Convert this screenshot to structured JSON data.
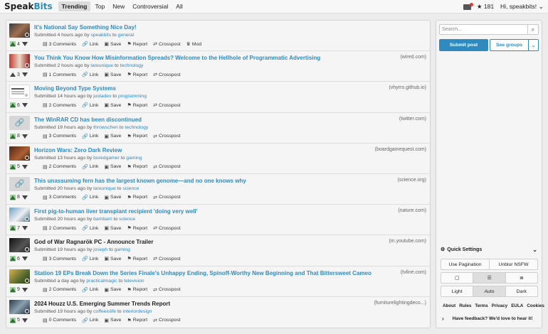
{
  "header": {
    "brand_a": "Speak",
    "brand_b": "Bits",
    "tabs": [
      "Trending",
      "Top",
      "New",
      "Controversial",
      "All"
    ],
    "active_tab": "Trending",
    "score": "181",
    "greeting": "Hi, speakbits!",
    "mail_icon": "mail-icon"
  },
  "labels": {
    "comments_suffix": "Comments",
    "link": "Link",
    "save": "Save",
    "report": "Report",
    "crosspost": "Crosspost",
    "mod": "Mod",
    "submitted": "Submitted",
    "by": "by",
    "to": "to"
  },
  "posts": [
    {
      "title": "It's National Say Something Nice Day!",
      "domain": "",
      "time": "4 hours ago",
      "user": "speakbits",
      "group": "general",
      "score": "4",
      "comments": "3",
      "voted": true,
      "thumb": "t1",
      "mod": true
    },
    {
      "title": "You Think You Know How Misinformation Spreads? Welcome to the Hellhole of Programmatic Advertising",
      "domain": "(wired.com)",
      "time": "2 hours ago",
      "user": "lareunique",
      "group": "technology",
      "score": "3",
      "comments": "1",
      "voted": false,
      "thumb": "t2"
    },
    {
      "title": "Moving Beyond Type Systems",
      "domain": "(vhyrro.github.io)",
      "time": "14 hours ago",
      "user": "justadev",
      "group": "programming",
      "score": "6",
      "comments": "2",
      "voted": true,
      "thumb": "t3"
    },
    {
      "title": "The WinRAR CD has been discontinued",
      "domain": "(twitter.com)",
      "time": "19 hours ago",
      "user": "throwschen",
      "group": "technology",
      "score": "8",
      "comments": "3",
      "voted": true,
      "thumb": "link"
    },
    {
      "title": "Horizon Wars: Zero Dark Review",
      "domain": "(boardgamequest.com)",
      "time": "13 hours ago",
      "user": "boredgamer",
      "group": "gaming",
      "score": "5",
      "comments": "2",
      "voted": true,
      "thumb": "t5"
    },
    {
      "title": "This unassuming fern has the largest known genome—and no one knows why",
      "domain": "(science.org)",
      "time": "20 hours ago",
      "user": "lareunique",
      "group": "science",
      "score": "8",
      "comments": "3",
      "voted": true,
      "thumb": "link"
    },
    {
      "title": "First pig-to-human liver transplant recipient 'doing very well'",
      "domain": "(nature.com)",
      "time": "20 hours ago",
      "user": "bambam",
      "group": "science",
      "score": "7",
      "comments": "2",
      "voted": true,
      "thumb": "t7"
    },
    {
      "title": "God of War Ragnarök PC - Announce Trailer",
      "domain": "(m.youtube.com)",
      "time": "19 hours ago",
      "user": "joseph",
      "group": "gaming",
      "score": "6",
      "comments": "3",
      "voted": true,
      "thumb": "t8",
      "dark": true
    },
    {
      "title": "Station 19 EPs Break Down the Series Finale's Unhappy Ending, Spinoff-Worthy New Beginning and That Bittersweet Cameo",
      "domain": "(tvline.com)",
      "time": "a day ago",
      "user": "practicalmagic",
      "group": "television",
      "score": "9",
      "comments": "2",
      "voted": true,
      "thumb": "t9"
    },
    {
      "title": "2024 Houzz U.S. Emerging Summer Trends Report",
      "domain": "(furniturelightingdeco...)",
      "time": "19 hours ago",
      "user": "coffeeislife",
      "group": "interiordesign",
      "score": "5",
      "comments": "0",
      "voted": true,
      "thumb": "t10",
      "dark": true
    }
  ],
  "sidebar": {
    "search_placeholder": "Search...",
    "submit": "Submit post",
    "see_groups": "See groups",
    "quick_settings": "Quick Settings",
    "pagination": "Use Pagination",
    "nsfw": "Unblur NSFW",
    "theme": [
      "Light",
      "Auto",
      "Dark"
    ],
    "footer_links": [
      "About",
      "Rules",
      "Terms",
      "Privacy",
      "EULA",
      "Cookies"
    ],
    "feedback": "Have feedback? We'd love to hear it!"
  }
}
